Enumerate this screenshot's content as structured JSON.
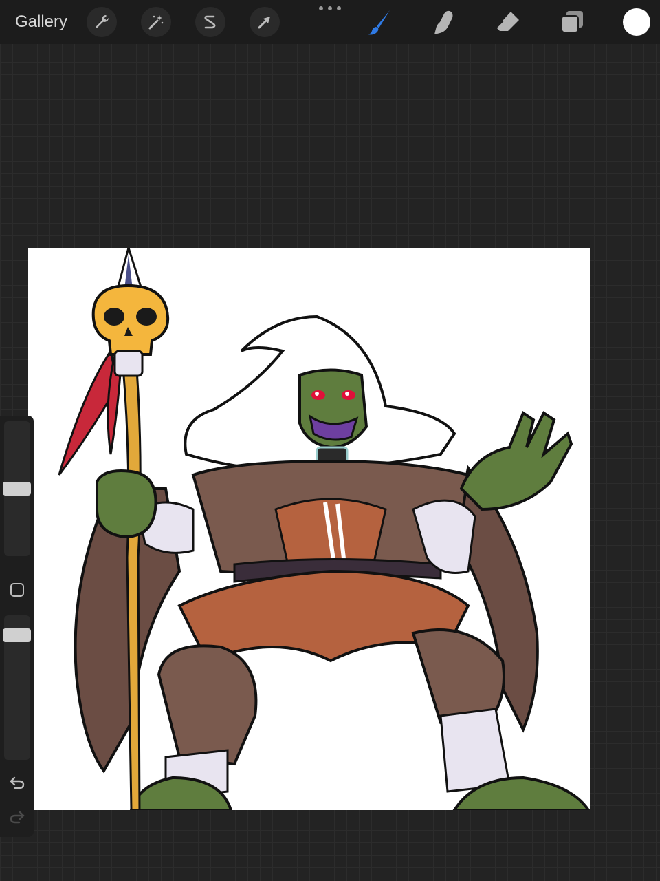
{
  "toolbar": {
    "gallery_label": "Gallery",
    "left_tools": [
      {
        "name": "actions",
        "icon": "wrench-icon"
      },
      {
        "name": "adjustments",
        "icon": "magic-wand-icon"
      },
      {
        "name": "selection",
        "icon": "selection-s-icon"
      },
      {
        "name": "transform",
        "icon": "arrow-cursor-icon"
      }
    ],
    "right_tools": [
      {
        "name": "brush",
        "icon": "brush-icon",
        "active": true
      },
      {
        "name": "smudge",
        "icon": "smudge-finger-icon",
        "active": false
      },
      {
        "name": "eraser",
        "icon": "eraser-icon",
        "active": false
      },
      {
        "name": "layers",
        "icon": "layers-icon",
        "active": false
      }
    ],
    "current_color": "#ffffff",
    "active_color": "#2f7ae5"
  },
  "sidebar": {
    "brush_size_level": 0.5,
    "opacity_level": 0.9,
    "modify_icon": "square-icon",
    "undo_icon": "undo-icon",
    "redo_icon": "redo-icon"
  },
  "canvas": {
    "content": "illustration"
  }
}
